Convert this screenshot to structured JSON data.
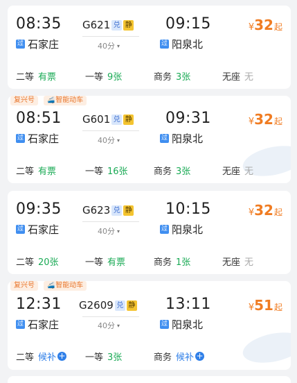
{
  "colors": {
    "accent_price": "#f07c22",
    "available": "#1aaa55",
    "none": "#aaaaaa",
    "waitlist": "#2f7fe8",
    "tag": "#e8772e"
  },
  "labels": {
    "pass_icon_text": "过",
    "dui_badge": "兑",
    "jing_badge": "静",
    "price_currency": "¥",
    "price_suffix": "起",
    "duration_caret": "▾",
    "plus": "+"
  },
  "tags": {
    "fuxing": "复兴号",
    "smart": "智能动车"
  },
  "trains": [
    {
      "dep_time": "08:35",
      "dep_station": "石家庄",
      "train_no": "G621",
      "duration": "40分",
      "arr_time": "09:15",
      "arr_station": "阳泉北",
      "price": "32",
      "seats": [
        {
          "name": "二等",
          "value": "有票",
          "status": "available"
        },
        {
          "name": "一等",
          "value": "9张",
          "status": "available"
        },
        {
          "name": "商务",
          "value": "3张",
          "status": "available"
        },
        {
          "name": "无座",
          "value": "无",
          "status": "none"
        }
      ]
    },
    {
      "dep_time": "08:51",
      "dep_station": "石家庄",
      "train_no": "G601",
      "duration": "40分",
      "arr_time": "09:31",
      "arr_station": "阳泉北",
      "price": "32",
      "seats": [
        {
          "name": "二等",
          "value": "有票",
          "status": "available"
        },
        {
          "name": "一等",
          "value": "16张",
          "status": "available"
        },
        {
          "name": "商务",
          "value": "3张",
          "status": "available"
        },
        {
          "name": "无座",
          "value": "无",
          "status": "none"
        }
      ]
    },
    {
      "dep_time": "09:35",
      "dep_station": "石家庄",
      "train_no": "G623",
      "duration": "40分",
      "arr_time": "10:15",
      "arr_station": "阳泉北",
      "price": "32",
      "seats": [
        {
          "name": "二等",
          "value": "20张",
          "status": "available"
        },
        {
          "name": "一等",
          "value": "有票",
          "status": "available"
        },
        {
          "name": "商务",
          "value": "1张",
          "status": "available"
        },
        {
          "name": "无座",
          "value": "无",
          "status": "none"
        }
      ]
    },
    {
      "dep_time": "12:31",
      "dep_station": "石家庄",
      "train_no": "G2609",
      "duration": "40分",
      "arr_time": "13:11",
      "arr_station": "阳泉北",
      "price": "51",
      "seats": [
        {
          "name": "二等",
          "value": "候补",
          "status": "waitlist"
        },
        {
          "name": "一等",
          "value": "3张",
          "status": "available"
        },
        {
          "name": "商务",
          "value": "候补",
          "status": "waitlist"
        }
      ]
    }
  ]
}
